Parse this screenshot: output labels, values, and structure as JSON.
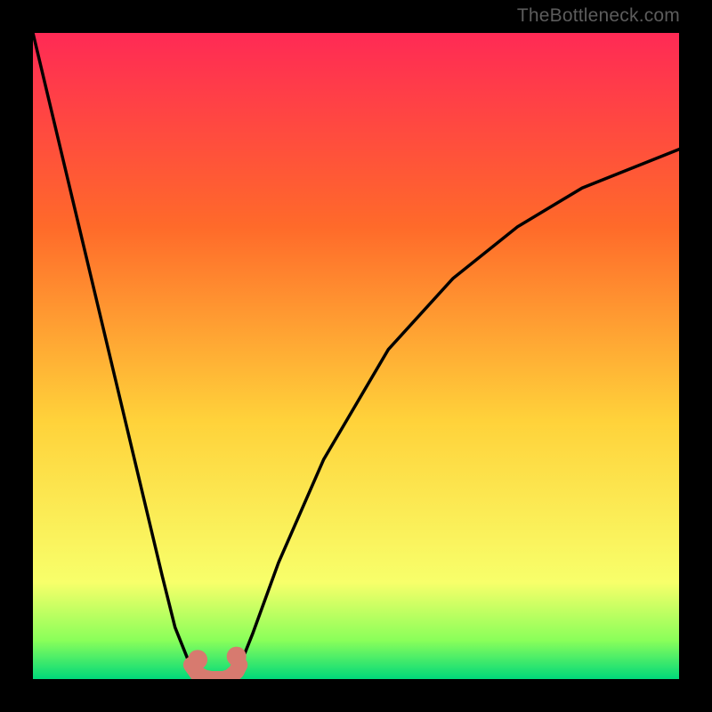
{
  "watermark": "TheBottleneck.com",
  "colors": {
    "background": "#000000",
    "grad_top": "#ff2a55",
    "grad_mid1": "#ff6a2a",
    "grad_mid2": "#ffd23a",
    "grad_low": "#f8ff6a",
    "grad_bottom1": "#8aff5a",
    "grad_bottom2": "#00d87a",
    "curve": "#000000",
    "marker": "#d77a6f"
  },
  "chart_data": {
    "type": "line",
    "title": "",
    "xlabel": "",
    "ylabel": "",
    "xlim": [
      0,
      100
    ],
    "ylim": [
      0,
      100
    ],
    "series": [
      {
        "name": "bottleneck-curve",
        "x": [
          0,
          5,
          10,
          15,
          20,
          22,
          24,
          26,
          27,
          28,
          29,
          30,
          31,
          32,
          34,
          38,
          45,
          55,
          65,
          75,
          85,
          100
        ],
        "y": [
          100,
          79,
          58,
          37,
          16,
          8,
          3,
          0.5,
          0,
          0,
          0,
          0,
          0.5,
          2,
          7,
          18,
          34,
          51,
          62,
          70,
          76,
          82
        ]
      }
    ],
    "markers": [
      {
        "name": "range-floor-left",
        "x": 25.5,
        "y": 1.0
      },
      {
        "name": "range-floor-right",
        "x": 31.5,
        "y": 1.5
      },
      {
        "name": "optimum-point",
        "x": 28.0,
        "y": 0.0
      }
    ],
    "annotations": []
  }
}
